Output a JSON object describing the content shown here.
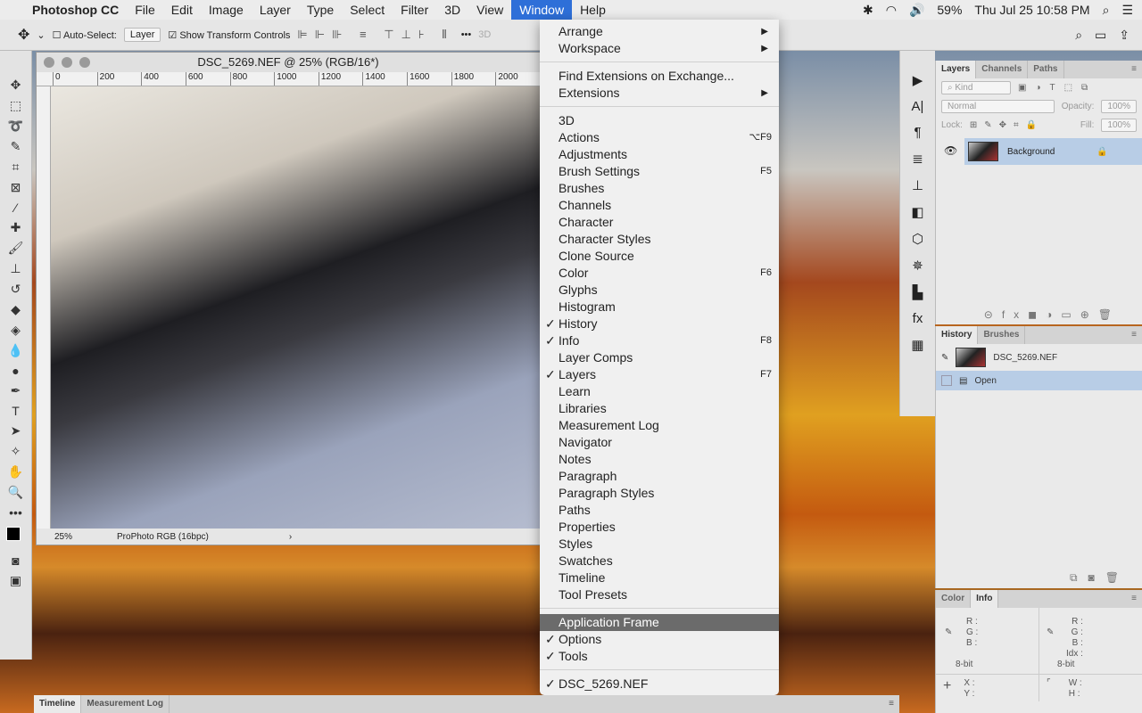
{
  "menubar": {
    "app": "Photoshop CC",
    "items": [
      "File",
      "Edit",
      "Image",
      "Layer",
      "Type",
      "Select",
      "Filter",
      "3D",
      "View",
      "Window",
      "Help"
    ],
    "battery": "59%",
    "datetime": "Thu Jul 25  10:58 PM"
  },
  "options": {
    "auto_select": "Auto-Select:",
    "auto_select_value": "Layer",
    "show_transform": "Show Transform Controls",
    "more": "•••",
    "mode3d": "3D"
  },
  "document": {
    "title": "DSC_5269.NEF @ 25% (RGB/16*)",
    "ruler": [
      "0",
      "200",
      "400",
      "600",
      "800",
      "1000",
      "1200",
      "1400",
      "1600",
      "1800",
      "2000"
    ],
    "zoom": "25%",
    "profile": "ProPhoto RGB (16bpc)"
  },
  "window_menu": {
    "groups": [
      [
        {
          "label": "Arrange",
          "submenu": true
        },
        {
          "label": "Workspace",
          "submenu": true
        }
      ],
      [
        {
          "label": "Find Extensions on Exchange..."
        },
        {
          "label": "Extensions",
          "submenu": true
        }
      ],
      [
        {
          "label": "3D"
        },
        {
          "label": "Actions",
          "shortcut": "⌥F9"
        },
        {
          "label": "Adjustments"
        },
        {
          "label": "Brush Settings",
          "shortcut": "F5"
        },
        {
          "label": "Brushes"
        },
        {
          "label": "Channels"
        },
        {
          "label": "Character"
        },
        {
          "label": "Character Styles"
        },
        {
          "label": "Clone Source"
        },
        {
          "label": "Color",
          "shortcut": "F6"
        },
        {
          "label": "Glyphs"
        },
        {
          "label": "Histogram"
        },
        {
          "label": "History",
          "checked": true
        },
        {
          "label": "Info",
          "checked": true,
          "shortcut": "F8"
        },
        {
          "label": "Layer Comps"
        },
        {
          "label": "Layers",
          "checked": true,
          "shortcut": "F7"
        },
        {
          "label": "Learn"
        },
        {
          "label": "Libraries"
        },
        {
          "label": "Measurement Log"
        },
        {
          "label": "Navigator"
        },
        {
          "label": "Notes"
        },
        {
          "label": "Paragraph"
        },
        {
          "label": "Paragraph Styles"
        },
        {
          "label": "Paths"
        },
        {
          "label": "Properties"
        },
        {
          "label": "Styles"
        },
        {
          "label": "Swatches"
        },
        {
          "label": "Timeline"
        },
        {
          "label": "Tool Presets"
        }
      ],
      [
        {
          "label": "Application Frame",
          "highlighted": true
        },
        {
          "label": "Options",
          "checked": true
        },
        {
          "label": "Tools",
          "checked": true
        }
      ],
      [
        {
          "label": "DSC_5269.NEF",
          "checked": true
        }
      ]
    ]
  },
  "layers_panel": {
    "tabs": [
      "Layers",
      "Channels",
      "Paths"
    ],
    "kind": "Kind",
    "blend": "Normal",
    "opacity_label": "Opacity:",
    "opacity": "100%",
    "lock_label": "Lock:",
    "fill_label": "Fill:",
    "fill": "100%",
    "layer": "Background"
  },
  "history_panel": {
    "tabs": [
      "History",
      "Brushes"
    ],
    "snapshot": "DSC_5269.NEF",
    "state": "Open"
  },
  "info_panel": {
    "tabs": [
      "Color",
      "Info"
    ],
    "left": [
      "R :",
      "G :",
      "B :"
    ],
    "right": [
      "R :",
      "G :",
      "B :",
      "Idx :"
    ],
    "bits": "8-bit",
    "xy": [
      "X :",
      "Y :"
    ],
    "wh": [
      "W :",
      "H :"
    ]
  },
  "bottom_tabs": [
    "Timeline",
    "Measurement Log"
  ],
  "colors": {
    "menu_highlight": "#6b6b6b",
    "layer_selected": "#b8cde6",
    "menubar_active": "#2e6fd8"
  }
}
